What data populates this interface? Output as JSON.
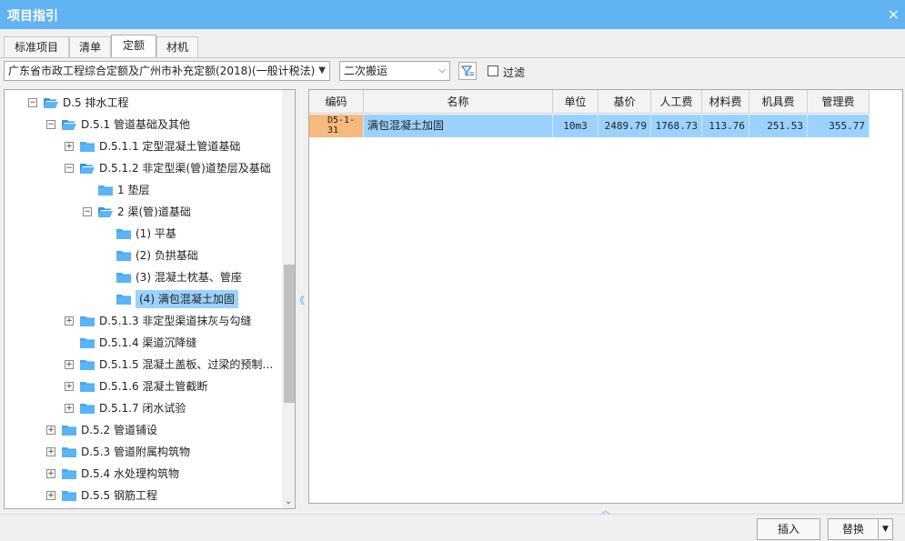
{
  "window": {
    "title": "项目指引",
    "close_glyph": "×"
  },
  "tabs": [
    {
      "label": "标准项目"
    },
    {
      "label": "清单"
    },
    {
      "label": "定额"
    },
    {
      "label": "材机"
    }
  ],
  "toolbar": {
    "quota_library": "广东省市政工程综合定额及广州市补充定额(2018)(一般计税法)",
    "search_value": "二次搬运",
    "filter_label": "过滤"
  },
  "tree": [
    {
      "text": "D.5 排水工程",
      "exp": "−"
    },
    {
      "text": "D.5.1 管道基础及其他",
      "exp": "−"
    },
    {
      "text": "D.5.1.1 定型混凝土管道基础",
      "exp": "+"
    },
    {
      "text": "D.5.1.2 非定型渠(管)道垫层及基础",
      "exp": "−"
    },
    {
      "text": "1 垫层",
      "exp": ""
    },
    {
      "text": "2 渠(管)道基础",
      "exp": "−"
    },
    {
      "text": "(1) 平基",
      "exp": ""
    },
    {
      "text": "(2) 负拱基础",
      "exp": ""
    },
    {
      "text": "(3) 混凝土枕基、管座",
      "exp": ""
    },
    {
      "text": "(4) 满包混凝土加固",
      "exp": ""
    },
    {
      "text": "D.5.1.3 非定型渠道抹灰与勾缝",
      "exp": "+"
    },
    {
      "text": "D.5.1.4 渠道沉降缝",
      "exp": ""
    },
    {
      "text": "D.5.1.5 混凝土盖板、过梁的预制…",
      "exp": "+"
    },
    {
      "text": "D.5.1.6 混凝土管截断",
      "exp": "+"
    },
    {
      "text": "D.5.1.7 闭水试验",
      "exp": "+"
    },
    {
      "text": "D.5.2 管道铺设",
      "exp": "+"
    },
    {
      "text": "D.5.3 管道附属构筑物",
      "exp": "+"
    },
    {
      "text": "D.5.4 水处理构筑物",
      "exp": "+"
    },
    {
      "text": "D.5.5 钢筋工程",
      "exp": "+"
    }
  ],
  "grid": {
    "headers": [
      "编码",
      "名称",
      "单位",
      "基价",
      "人工费",
      "材料费",
      "机具费",
      "管理费"
    ],
    "row": {
      "code_line1": "D5-1-",
      "code_line2": "31",
      "name": "满包混凝土加固",
      "unit": "10m3",
      "base_price": "2489.79",
      "labor": "1768.73",
      "material": "113.76",
      "machine": "251.53",
      "management": "355.77"
    }
  },
  "buttons": {
    "insert": "插入",
    "replace": "替换"
  },
  "colors": {
    "titlebar": "#62b3f2",
    "selection": "#9cd2ff",
    "code_cell": "#f7b97e",
    "folder": "#4aaaf0"
  }
}
